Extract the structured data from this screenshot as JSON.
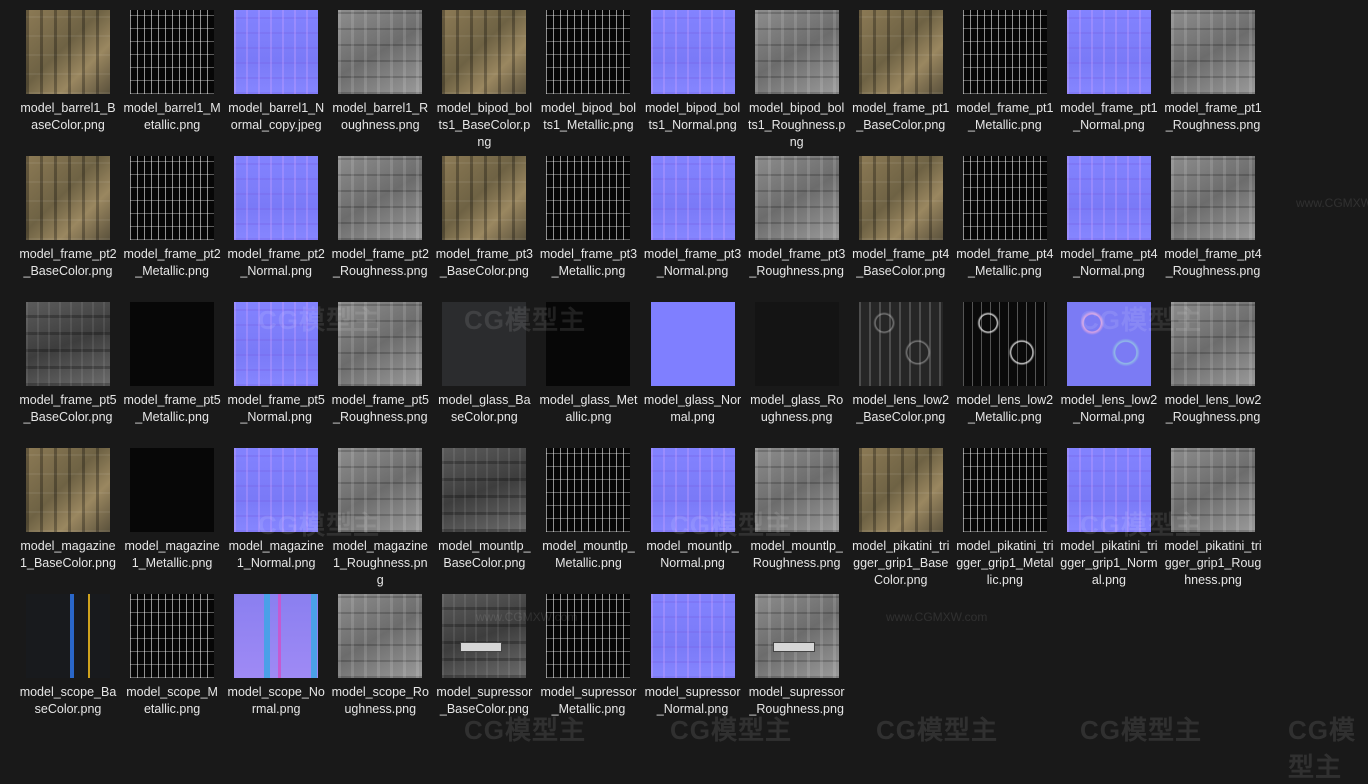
{
  "files": [
    {
      "name": "model_barrel1_BaseColor.png",
      "tex": "t-basecolor"
    },
    {
      "name": "model_barrel1_Metallic.png",
      "tex": "t-metallic"
    },
    {
      "name": "model_barrel1_Normal_copy.jpeg",
      "tex": "t-normal"
    },
    {
      "name": "model_barrel1_Roughness.png",
      "tex": "t-rough"
    },
    {
      "name": "model_bipod_bolts1_BaseColor.png",
      "tex": "t-basecolor"
    },
    {
      "name": "model_bipod_bolts1_Metallic.png",
      "tex": "t-metallic"
    },
    {
      "name": "model_bipod_bolts1_Normal.png",
      "tex": "t-normal"
    },
    {
      "name": "model_bipod_bolts1_Roughness.png",
      "tex": "t-rough"
    },
    {
      "name": "model_frame_pt1_BaseColor.png",
      "tex": "t-basecolor"
    },
    {
      "name": "model_frame_pt1_Metallic.png",
      "tex": "t-metallic"
    },
    {
      "name": "model_frame_pt1_Normal.png",
      "tex": "t-normal"
    },
    {
      "name": "model_frame_pt1_Roughness.png",
      "tex": "t-rough"
    },
    {
      "name": "model_frame_pt2_BaseColor.png",
      "tex": "t-basecolor"
    },
    {
      "name": "model_frame_pt2_Metallic.png",
      "tex": "t-metallic"
    },
    {
      "name": "model_frame_pt2_Normal.png",
      "tex": "t-normal"
    },
    {
      "name": "model_frame_pt2_Roughness.png",
      "tex": "t-rough"
    },
    {
      "name": "model_frame_pt3_BaseColor.png",
      "tex": "t-basecolor"
    },
    {
      "name": "model_frame_pt3_Metallic.png",
      "tex": "t-metallic"
    },
    {
      "name": "model_frame_pt3_Normal.png",
      "tex": "t-normal"
    },
    {
      "name": "model_frame_pt3_Roughness.png",
      "tex": "t-rough"
    },
    {
      "name": "model_frame_pt4_BaseColor.png",
      "tex": "t-basecolor"
    },
    {
      "name": "model_frame_pt4_Metallic.png",
      "tex": "t-metallic"
    },
    {
      "name": "model_frame_pt4_Normal.png",
      "tex": "t-normal"
    },
    {
      "name": "model_frame_pt4_Roughness.png",
      "tex": "t-rough"
    },
    {
      "name": "model_frame_pt5_BaseColor.png",
      "tex": "t-basecolor-gray"
    },
    {
      "name": "model_frame_pt5_Metallic.png",
      "tex": "t-black"
    },
    {
      "name": "model_frame_pt5_Normal.png",
      "tex": "t-normal"
    },
    {
      "name": "model_frame_pt5_Roughness.png",
      "tex": "t-rough"
    },
    {
      "name": "model_glass_BaseColor.png",
      "tex": "t-darkgray"
    },
    {
      "name": "model_glass_Metallic.png",
      "tex": "t-black"
    },
    {
      "name": "model_glass_Normal.png",
      "tex": "t-normal-flat"
    },
    {
      "name": "model_glass_Roughness.png",
      "tex": "t-verydark"
    },
    {
      "name": "model_lens_low2_BaseColor.png",
      "tex": "t-lens"
    },
    {
      "name": "model_lens_low2_Metallic.png",
      "tex": "t-lens-metal"
    },
    {
      "name": "model_lens_low2_Normal.png",
      "tex": "t-lens-normal"
    },
    {
      "name": "model_lens_low2_Roughness.png",
      "tex": "t-rough"
    },
    {
      "name": "model_magazine1_BaseColor.png",
      "tex": "t-basecolor"
    },
    {
      "name": "model_magazine1_Metallic.png",
      "tex": "t-black"
    },
    {
      "name": "model_magazine1_Normal.png",
      "tex": "t-normal"
    },
    {
      "name": "model_magazine1_Roughness.png",
      "tex": "t-rough"
    },
    {
      "name": "model_mountlp_BaseColor.png",
      "tex": "t-basecolor-gray"
    },
    {
      "name": "model_mountlp_Metallic.png",
      "tex": "t-metallic"
    },
    {
      "name": "model_mountlp_Normal.png",
      "tex": "t-normal"
    },
    {
      "name": "model_mountlp_Roughness.png",
      "tex": "t-rough"
    },
    {
      "name": "model_pikatini_trigger_grip1_BaseColor.png",
      "tex": "t-basecolor"
    },
    {
      "name": "model_pikatini_trigger_grip1_Metallic.png",
      "tex": "t-metallic"
    },
    {
      "name": "model_pikatini_trigger_grip1_Normal.png",
      "tex": "t-normal"
    },
    {
      "name": "model_pikatini_trigger_grip1_Roughness.png",
      "tex": "t-rough"
    },
    {
      "name": "model_scope_BaseColor.png",
      "tex": "t-scope-color"
    },
    {
      "name": "model_scope_Metallic.png",
      "tex": "t-metallic"
    },
    {
      "name": "model_scope_Normal.png",
      "tex": "t-scope-normal"
    },
    {
      "name": "model_scope_Roughness.png",
      "tex": "t-rough"
    },
    {
      "name": "model_supressor_BaseColor.png",
      "tex": "t-basecolor-gray",
      "badge": true
    },
    {
      "name": "model_supressor_Metallic.png",
      "tex": "t-metallic"
    },
    {
      "name": "model_supressor_Normal.png",
      "tex": "t-normal"
    },
    {
      "name": "model_supressor_Roughness.png",
      "tex": "t-rough",
      "badge": true
    }
  ],
  "watermark": {
    "logo": "CG模型主",
    "url": "www.CGMXW.com"
  }
}
